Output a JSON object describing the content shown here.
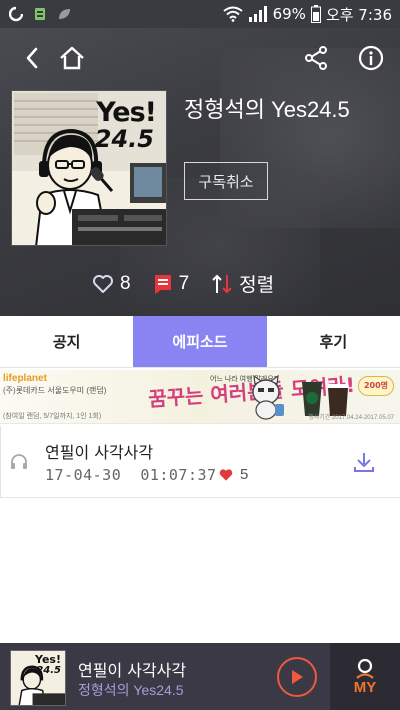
{
  "status_bar": {
    "battery": "69%",
    "time": "오후 7:36",
    "icons": [
      "app-o-icon",
      "sim-icon",
      "leaf-icon",
      "wifi-icon",
      "signal-icon",
      "battery-icon"
    ]
  },
  "header": {
    "back_icon": "back-chevron-icon",
    "home_icon": "home-icon",
    "share_icon": "share-icon",
    "info_icon": "info-icon"
  },
  "podcast": {
    "title": "정형석의 Yes24.5",
    "cover_title": "Yes!",
    "cover_subtitle": "24.5",
    "unsubscribe_label": "구독취소",
    "likes": "8",
    "comments": "7",
    "sort_label": "정렬"
  },
  "tabs": [
    {
      "label": "공지",
      "active": false
    },
    {
      "label": "에피소드",
      "active": true
    },
    {
      "label": "후기",
      "active": false
    }
  ],
  "banner": {
    "logo_main": "lifeplan",
    "logo_accent": "et",
    "line1": "(주)롯데카드 서울도우미 (랜덤)",
    "headline": "꿈꾸는 여러분들 모여라!",
    "small": "어느 나라 여행 갈래요?",
    "badge": "200명",
    "footer": "(참여일 랜덤, 5/7일까지, 1인 1회)",
    "fine": "행사기간 2017.04.24-2017.05.07"
  },
  "episodes": [
    {
      "title": "연필이 사각사각",
      "date": "17-04-30",
      "duration": "01:07:37",
      "likes": "5"
    }
  ],
  "player": {
    "title": "연필이 사각사각",
    "subtitle": "정형석의 Yes24.5",
    "cover_title": "Yes!",
    "cover_subtitle": "24.5",
    "my_label": "MY"
  },
  "colors": {
    "accent": "#8a84f2",
    "heart_red": "#e03a3a",
    "comment_red": "#e8343c",
    "play_orange": "#ef5a3c",
    "my_orange": "#f0762e"
  }
}
